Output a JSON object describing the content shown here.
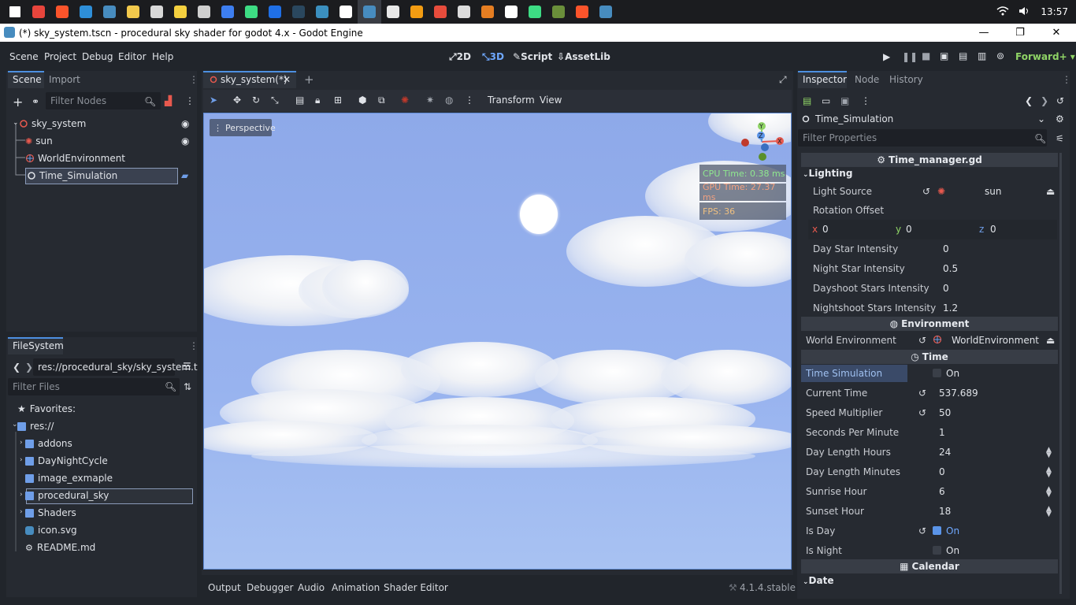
{
  "taskbar": {
    "icons": [
      {
        "name": "windows-start-icon",
        "color": "#ffffff"
      },
      {
        "name": "chrome-icon",
        "color": "#e8453c"
      },
      {
        "name": "brave-icon",
        "color": "#fb542b"
      },
      {
        "name": "vscode-icon",
        "color": "#2e8fd9"
      },
      {
        "name": "godot-icon",
        "color": "#478cbf"
      },
      {
        "name": "file-explorer-icon",
        "color": "#f2c94c"
      },
      {
        "name": "app-icon",
        "color": "#d8d8d8"
      },
      {
        "name": "duck-icon",
        "color": "#f4d03f"
      },
      {
        "name": "check-icon",
        "color": "#cfcfcf"
      },
      {
        "name": "store-icon",
        "color": "#3d7ef0"
      },
      {
        "name": "android-icon",
        "color": "#3ddc84"
      },
      {
        "name": "app-blue-icon",
        "color": "#1f6fe6"
      },
      {
        "name": "steam-icon",
        "color": "#2a475e"
      },
      {
        "name": "terminal-icon",
        "color": "#3b8fbf"
      },
      {
        "name": "b-icon",
        "color": "#ffffff"
      },
      {
        "name": "godot-active-icon",
        "color": "#478cbf"
      },
      {
        "name": "document-icon",
        "color": "#e8e8e8"
      },
      {
        "name": "search-app-icon",
        "color": "#f39c12"
      },
      {
        "name": "record-icon",
        "color": "#e74c3c"
      },
      {
        "name": "notes-icon",
        "color": "#dcdcdc"
      },
      {
        "name": "cube-icon",
        "color": "#e67e22"
      },
      {
        "name": "qr-icon",
        "color": "#ffffff"
      },
      {
        "name": "android-studio-icon",
        "color": "#3ddc84"
      },
      {
        "name": "minecraft-icon",
        "color": "#6a8f3a"
      },
      {
        "name": "brave-dev-icon",
        "color": "#fb542b"
      },
      {
        "name": "godot-extra-icon",
        "color": "#478cbf"
      }
    ],
    "clock": "13:57"
  },
  "window": {
    "title": "(*) sky_system.tscn - procedural sky shader for godot 4.x - Godot Engine",
    "minimize": "—",
    "maximize": "❐",
    "close": "✕"
  },
  "menu": {
    "items": [
      "Scene",
      "Project",
      "Debug",
      "Editor",
      "Help"
    ],
    "workspaces": [
      "2D",
      "3D",
      "Script",
      "AssetLib"
    ],
    "workspace_selected": "3D",
    "renderer": "Forward+"
  },
  "scene_dock": {
    "tabs": [
      "Scene",
      "Import"
    ],
    "filter_placeholder": "Filter Nodes",
    "nodes": [
      {
        "label": "sky_system",
        "icon": "node3d-icon",
        "color": "#e8594e"
      },
      {
        "label": "sun",
        "icon": "sun-icon",
        "color": "#e8594e"
      },
      {
        "label": "WorldEnvironment",
        "icon": "world-environment-icon",
        "color": "#e8594e"
      },
      {
        "label": "Time_Simulation",
        "icon": "node-icon",
        "color": "#e0e3e8"
      }
    ]
  },
  "filesystem_dock": {
    "tab": "FileSystem",
    "path": "res://procedural_sky/sky_system.t",
    "filter_placeholder": "Filter Files",
    "favorites": "Favorites:",
    "root": "res://",
    "items": [
      "addons",
      "DayNightCycle",
      "image_exmaple",
      "procedural_sky",
      "Shaders",
      "icon.svg",
      "README.md"
    ]
  },
  "viewport": {
    "tab_label": "sky_system(*)",
    "toolbar_labels": [
      "Transform",
      "View"
    ],
    "perspective_label": "Perspective",
    "cpu_time": "CPU Time: 0.38 ms",
    "gpu_time": "GPU Time: 27.37 ms",
    "fps": "FPS: 36",
    "gizmo": {
      "x": "X",
      "y": "Y",
      "z": "Z"
    }
  },
  "bottom_panel": {
    "tabs": [
      "Output",
      "Debugger",
      "Audio",
      "Animation",
      "Shader Editor"
    ],
    "version": "4.1.4.stable"
  },
  "inspector": {
    "tabs": [
      "Inspector",
      "Node",
      "History"
    ],
    "node_name": "Time_Simulation",
    "filter_placeholder": "Filter Properties",
    "script_name": "Time_manager.gd",
    "lighting": {
      "header": "Lighting",
      "light_source_label": "Light Source",
      "light_source_value": "sun",
      "rotation_offset_label": "Rotation Offset",
      "rotation": {
        "x_label": "x",
        "x": "0",
        "y_label": "y",
        "y": "0",
        "z_label": "z",
        "z": "0"
      },
      "props": [
        {
          "label": "Day Star Intensity",
          "value": "0"
        },
        {
          "label": "Night Star Intensity",
          "value": "0.5"
        },
        {
          "label": "Dayshoot Stars Intensity",
          "value": "0"
        },
        {
          "label": "Nightshoot Stars Intensity",
          "value": "1.2"
        }
      ]
    },
    "environment": {
      "header": "Environment",
      "label": "World Environment",
      "value": "WorldEnvironment"
    },
    "time": {
      "header": "Time",
      "time_simulation_label": "Time Simulation",
      "time_simulation_value": "On",
      "props": [
        {
          "label": "Current Time",
          "value": "537.689"
        },
        {
          "label": "Speed Multiplier",
          "value": "50"
        },
        {
          "label": "Seconds Per Minute",
          "value": "1"
        },
        {
          "label": "Day Length Hours",
          "value": "24"
        },
        {
          "label": "Day Length Minutes",
          "value": "0"
        },
        {
          "label": "Sunrise Hour",
          "value": "6"
        },
        {
          "label": "Sunset Hour",
          "value": "18"
        }
      ],
      "is_day_label": "Is Day",
      "is_day_value": "On",
      "is_night_label": "Is Night",
      "is_night_value": "On"
    },
    "calendar": {
      "header": "Calendar",
      "date_header": "Date"
    }
  }
}
